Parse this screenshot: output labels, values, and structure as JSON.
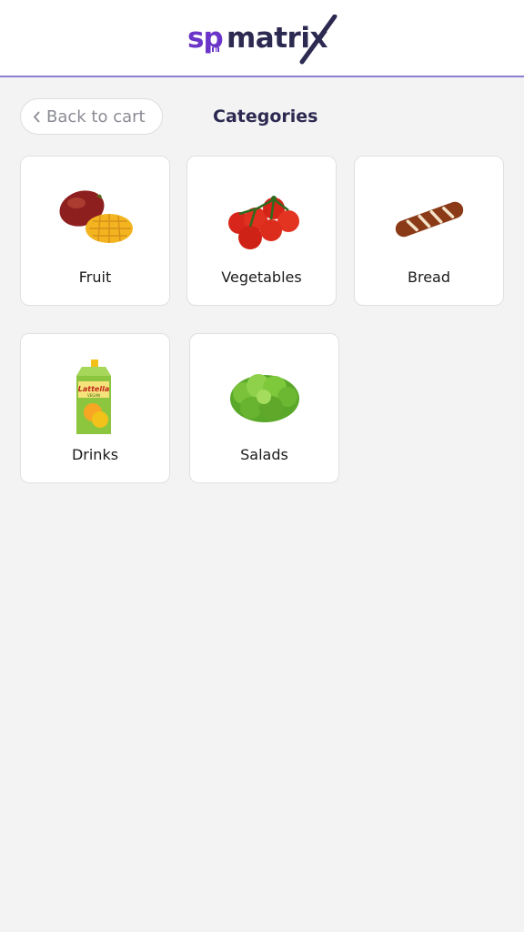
{
  "brand": {
    "prefix": "sp",
    "name": "matrix"
  },
  "nav": {
    "back_label": "Back to cart"
  },
  "page": {
    "title": "Categories"
  },
  "categories": [
    {
      "label": "Fruit",
      "icon": "mango-image"
    },
    {
      "label": "Vegetables",
      "icon": "tomatoes-image"
    },
    {
      "label": "Bread",
      "icon": "pretzel-baguette-image"
    },
    {
      "label": "Drinks",
      "icon": "juice-carton-image",
      "carton_text": "Lattella",
      "carton_subtext": "VEGAN"
    },
    {
      "label": "Salads",
      "icon": "lettuce-image"
    }
  ],
  "colors": {
    "accent": "#6a35c8",
    "brand_dark": "#2d2a52",
    "background": "#f3f3f3",
    "header_border": "#8a7fd0"
  }
}
